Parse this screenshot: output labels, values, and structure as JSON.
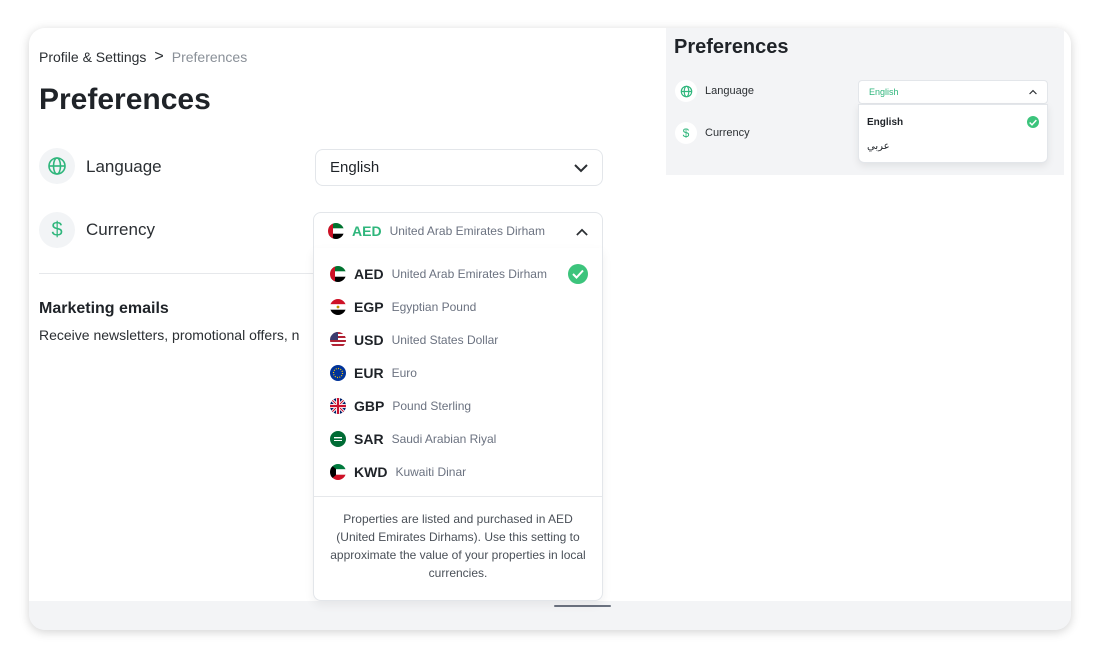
{
  "breadcrumb": {
    "parent": "Profile & Settings",
    "separator": ">",
    "current": "Preferences"
  },
  "page_title": "Preferences",
  "language": {
    "label": "Language",
    "value": "English",
    "icon": "globe-icon"
  },
  "currency": {
    "label": "Currency",
    "icon": "dollar-icon",
    "selected": {
      "code": "AED",
      "name": "United Arab Emirates Dirham"
    },
    "options": [
      {
        "code": "AED",
        "name": "United Arab Emirates Dirham",
        "selected": true
      },
      {
        "code": "EGP",
        "name": "Egyptian Pound"
      },
      {
        "code": "USD",
        "name": "United States Dollar"
      },
      {
        "code": "EUR",
        "name": "Euro"
      },
      {
        "code": "GBP",
        "name": "Pound Sterling"
      },
      {
        "code": "SAR",
        "name": "Saudi Arabian Riyal"
      },
      {
        "code": "KWD",
        "name": "Kuwaiti Dinar"
      }
    ],
    "note": "Properties are listed and purchased in AED (United Emirates Dirhams). Use this setting to approximate the value of your properties in local currencies."
  },
  "marketing": {
    "title": "Marketing emails",
    "description": "Receive newsletters, promotional offers, n"
  },
  "preview": {
    "title": "Preferences",
    "language_label": "Language",
    "currency_label": "Currency",
    "language_value": "English",
    "language_options": [
      {
        "label": "English",
        "selected": true
      },
      {
        "label": "عربي"
      }
    ]
  },
  "colors": {
    "accent": "#2fb67c",
    "check": "#3cc47c",
    "text": "#1f2328",
    "muted": "#8a9098"
  }
}
